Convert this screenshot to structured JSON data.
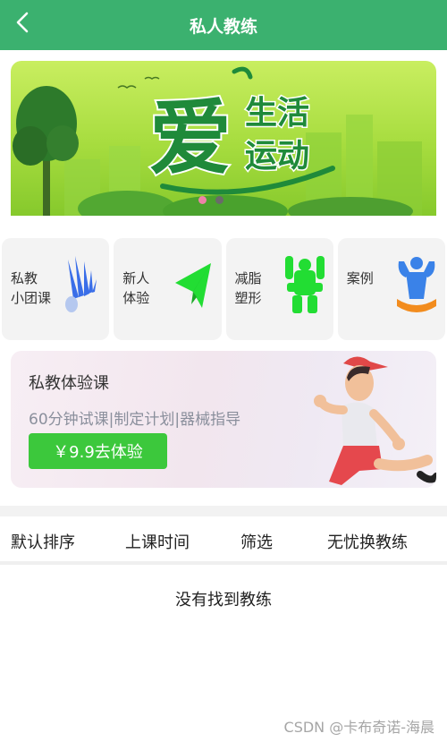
{
  "header": {
    "title": "私人教练",
    "back_icon": "chevron-left-icon"
  },
  "banner": {
    "logo_big": "爱",
    "logo_line1": "生活",
    "logo_line2": "运动",
    "slides": 2,
    "active_slide": 1
  },
  "categories": [
    {
      "line1": "私教",
      "line2": "小团课",
      "icon": "badminton-shuttlecock-icon",
      "color": "#3a6ee8"
    },
    {
      "line1": "新人",
      "line2": "体验",
      "icon": "paper-plane-icon",
      "color": "#22dd33"
    },
    {
      "line1": "减脂",
      "line2": "塑形",
      "icon": "muscle-body-icon",
      "color": "#22dd33"
    },
    {
      "line1": "案例",
      "line2": "",
      "icon": "bodybuilder-trophy-icon",
      "color": "#3a82e8"
    }
  ],
  "promo": {
    "title": "私教体验课",
    "desc": "60分钟试课|制定计划|器械指导",
    "button": "￥9.9去体验"
  },
  "sort": {
    "default": "默认排序",
    "time": "上课时间",
    "filter": "筛选",
    "swap": "无忧换教练"
  },
  "empty_text": "没有找到教练",
  "watermark": "CSDN @卡布奇诺-海晨",
  "colors": {
    "primary": "#3bb16f",
    "button": "#3cc83c"
  }
}
